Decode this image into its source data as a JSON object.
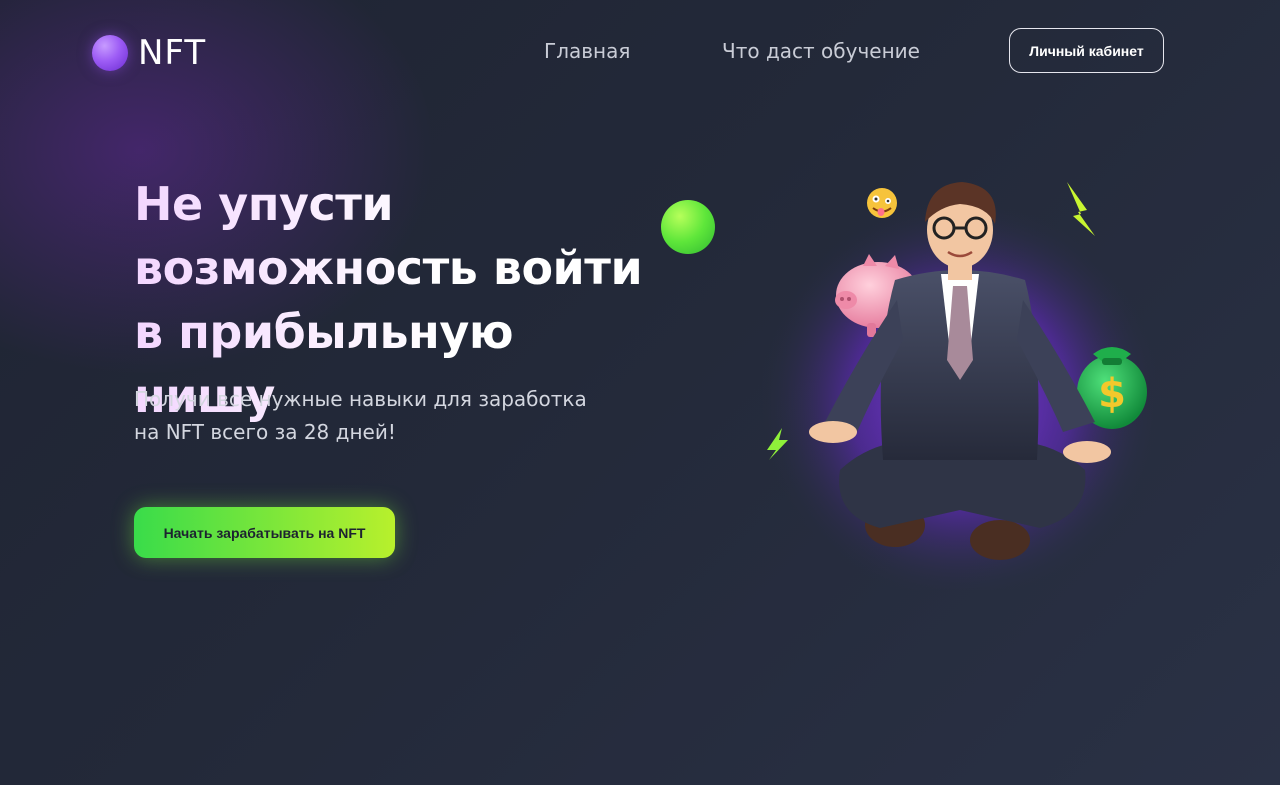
{
  "header": {
    "logo_text": "NFT",
    "nav": [
      {
        "label": "Главная"
      },
      {
        "label": "Что даст обучение"
      }
    ],
    "cabinet_button": "Личный кабинет"
  },
  "hero": {
    "title_lines": [
      "Не упусти",
      "возможность войти",
      "в прибыльную нишу"
    ],
    "subtitle_lines": [
      "Получи все нужные навыки для заработка",
      "на NFT всего за 28 дней!"
    ],
    "cta_label": "Начать зарабатывать на NFT",
    "money_symbol": "$"
  },
  "colors": {
    "background": "#232939",
    "accent_purple": "#9d5cf5",
    "accent_green": "#5ee63a",
    "cta_gradient_start": "#39dc4a",
    "cta_gradient_end": "#b8f02c"
  },
  "icons": [
    "logo-orb-icon",
    "green-sphere-icon",
    "lightning-icon",
    "piggy-bank-icon",
    "money-bag-icon",
    "emoji-icon"
  ]
}
